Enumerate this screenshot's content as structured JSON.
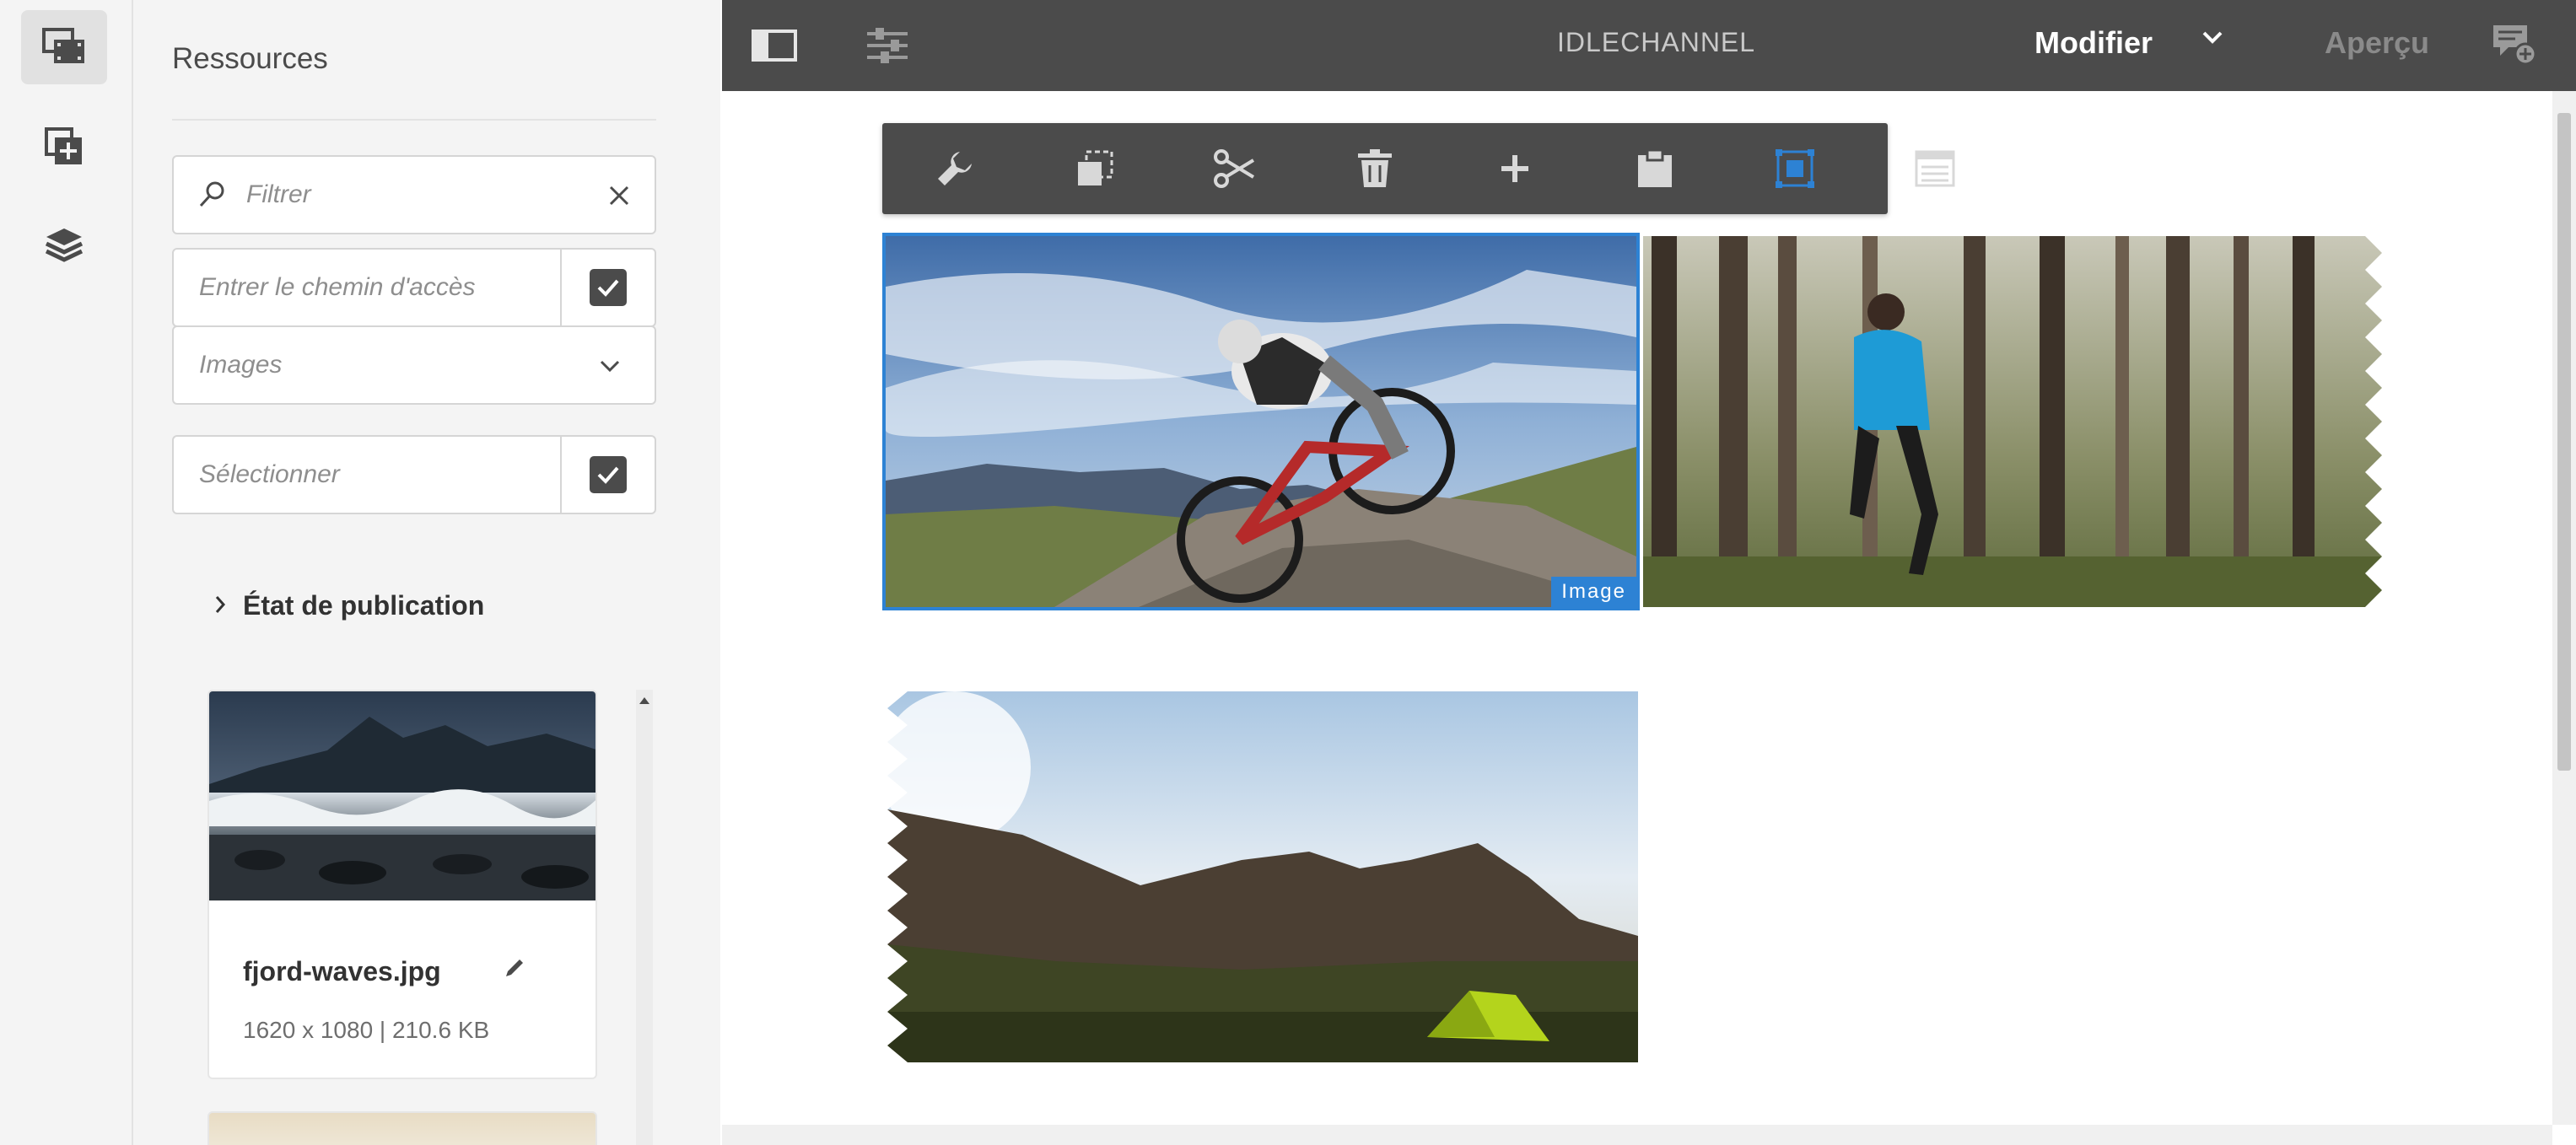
{
  "sidebar": {
    "rail_icons": [
      "assets-icon",
      "components-icon",
      "content-tree-icon"
    ]
  },
  "assets_panel": {
    "title": "Ressources",
    "filter_placeholder": "Filtrer",
    "path_placeholder": "Entrer le chemin d'accès",
    "type_select_value": "Images",
    "select_placeholder": "Sélectionner",
    "publication_status_label": "État de publication",
    "asset": {
      "name": "fjord-waves.jpg",
      "meta": "1620 x 1080 | 210.6 KB"
    }
  },
  "header": {
    "channel_name": "IDLECHANNEL",
    "mode_label": "Modifier",
    "preview_label": "Aperçu"
  },
  "component_toolbar": {
    "buttons": [
      "wrench-icon",
      "copy-icon",
      "scissors-icon",
      "trash-icon",
      "plus-icon",
      "clipboard-icon",
      "group-icon",
      "layout-icon"
    ],
    "active_button": "group-icon"
  },
  "editor": {
    "selected_component_label": "Image"
  },
  "colors": {
    "header_bg": "#4b4b4b",
    "selection_blue": "#2d82d4",
    "panel_bg": "#f4f4f4"
  }
}
